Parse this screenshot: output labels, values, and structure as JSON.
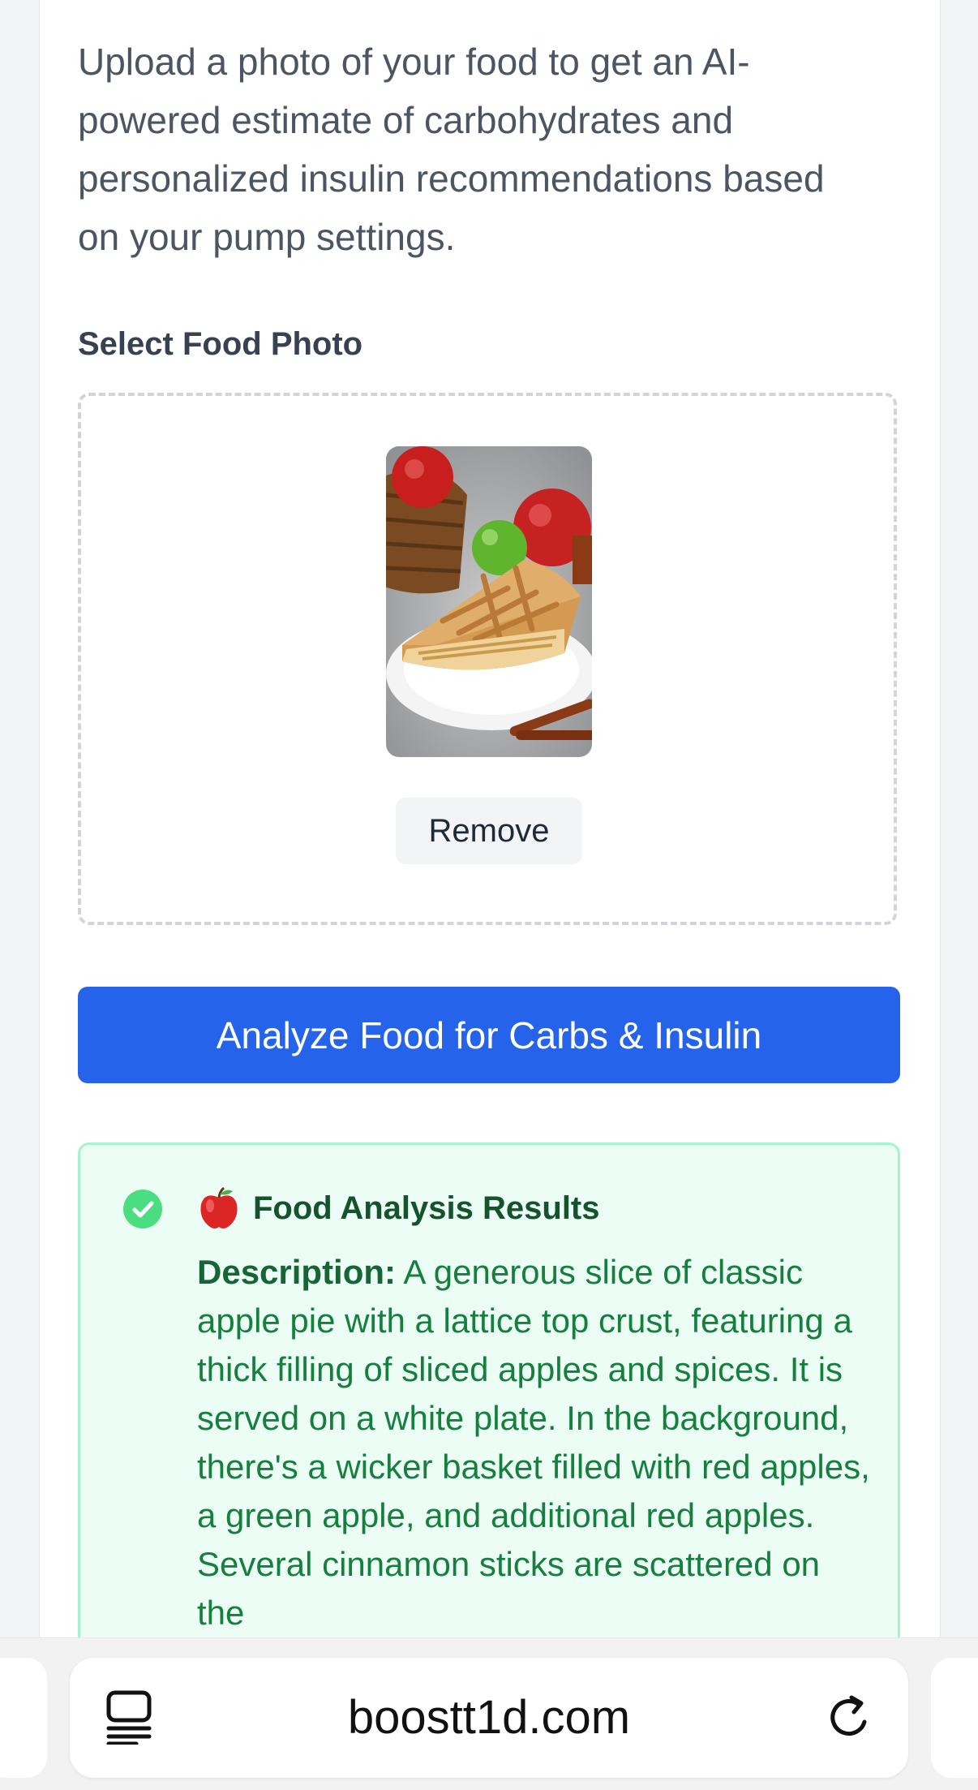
{
  "intro": {
    "text": "Upload a photo of your food to get an AI-powered estimate of carbohydrates and personalized insulin recommendations based on your pump settings."
  },
  "upload": {
    "label": "Select Food Photo",
    "remove_label": "Remove",
    "photo_icon": "apple-pie-photo"
  },
  "analyze": {
    "button_label": "Analyze Food for Carbs & Insulin"
  },
  "results": {
    "status_icon": "check-circle-icon",
    "title_icon": "red-apple-emoji",
    "title": "Food Analysis Results",
    "description_label": "Description:",
    "description_text": "A generous slice of classic apple pie with a lattice top crust, featuring a thick filling of sliced apples and spices. It is served on a white plate. In the background, there's a wicker basket filled with red apples, a green apple, and additional red apples. Several cinnamon sticks are scattered on the"
  },
  "browser": {
    "url": "boostt1d.com",
    "tabs_icon": "tabs-icon",
    "reload_icon": "reload-icon"
  },
  "colors": {
    "primary": "#2563eb",
    "success_bg": "#ecfdf5",
    "success_border": "#a7f3d0",
    "success_text": "#15803d",
    "check": "#4ade80"
  }
}
